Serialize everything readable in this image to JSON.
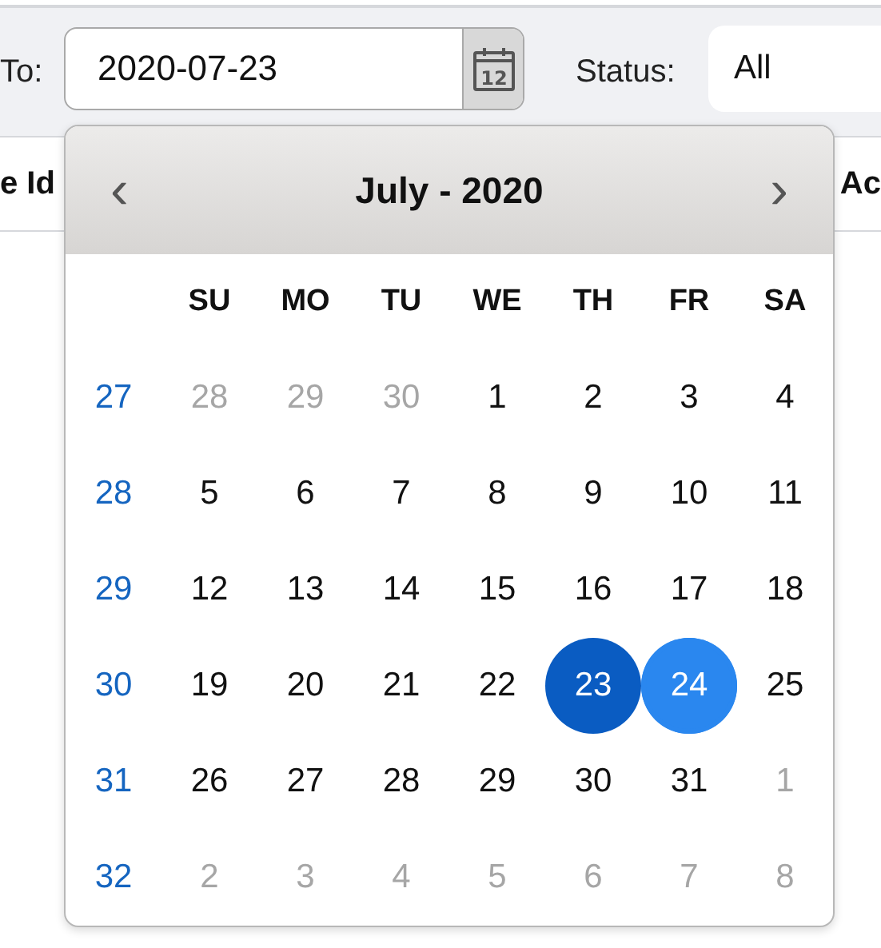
{
  "filter_bar": {
    "to_label": "To:",
    "to_field": {
      "value": "2020-07-23",
      "button_icon_day": "12"
    },
    "status_label": "Status:",
    "status_select": {
      "value": "All"
    }
  },
  "table": {
    "columns": [
      "e Id",
      "Ac"
    ]
  },
  "date_picker": {
    "title": "July - 2020",
    "prev": "‹",
    "next": "›",
    "weekdays": [
      "SU",
      "MO",
      "TU",
      "WE",
      "TH",
      "FR",
      "SA"
    ],
    "weeks": [
      {
        "number": "27",
        "days": [
          {
            "label": "28",
            "other_month": true,
            "selected": false,
            "highlighted": false
          },
          {
            "label": "29",
            "other_month": true,
            "selected": false,
            "highlighted": false
          },
          {
            "label": "30",
            "other_month": true,
            "selected": false,
            "highlighted": false
          },
          {
            "label": "1",
            "other_month": false,
            "selected": false,
            "highlighted": false
          },
          {
            "label": "2",
            "other_month": false,
            "selected": false,
            "highlighted": false
          },
          {
            "label": "3",
            "other_month": false,
            "selected": false,
            "highlighted": false
          },
          {
            "label": "4",
            "other_month": false,
            "selected": false,
            "highlighted": false
          }
        ]
      },
      {
        "number": "28",
        "days": [
          {
            "label": "5",
            "other_month": false,
            "selected": false,
            "highlighted": false
          },
          {
            "label": "6",
            "other_month": false,
            "selected": false,
            "highlighted": false
          },
          {
            "label": "7",
            "other_month": false,
            "selected": false,
            "highlighted": false
          },
          {
            "label": "8",
            "other_month": false,
            "selected": false,
            "highlighted": false
          },
          {
            "label": "9",
            "other_month": false,
            "selected": false,
            "highlighted": false
          },
          {
            "label": "10",
            "other_month": false,
            "selected": false,
            "highlighted": false
          },
          {
            "label": "11",
            "other_month": false,
            "selected": false,
            "highlighted": false
          }
        ]
      },
      {
        "number": "29",
        "days": [
          {
            "label": "12",
            "other_month": false,
            "selected": false,
            "highlighted": false
          },
          {
            "label": "13",
            "other_month": false,
            "selected": false,
            "highlighted": false
          },
          {
            "label": "14",
            "other_month": false,
            "selected": false,
            "highlighted": false
          },
          {
            "label": "15",
            "other_month": false,
            "selected": false,
            "highlighted": false
          },
          {
            "label": "16",
            "other_month": false,
            "selected": false,
            "highlighted": false
          },
          {
            "label": "17",
            "other_month": false,
            "selected": false,
            "highlighted": false
          },
          {
            "label": "18",
            "other_month": false,
            "selected": false,
            "highlighted": false
          }
        ]
      },
      {
        "number": "30",
        "days": [
          {
            "label": "19",
            "other_month": false,
            "selected": false,
            "highlighted": false
          },
          {
            "label": "20",
            "other_month": false,
            "selected": false,
            "highlighted": false
          },
          {
            "label": "21",
            "other_month": false,
            "selected": false,
            "highlighted": false
          },
          {
            "label": "22",
            "other_month": false,
            "selected": false,
            "highlighted": false
          },
          {
            "label": "23",
            "other_month": false,
            "selected": true,
            "highlighted": false
          },
          {
            "label": "24",
            "other_month": false,
            "selected": false,
            "highlighted": true
          },
          {
            "label": "25",
            "other_month": false,
            "selected": false,
            "highlighted": false
          }
        ]
      },
      {
        "number": "31",
        "days": [
          {
            "label": "26",
            "other_month": false,
            "selected": false,
            "highlighted": false
          },
          {
            "label": "27",
            "other_month": false,
            "selected": false,
            "highlighted": false
          },
          {
            "label": "28",
            "other_month": false,
            "selected": false,
            "highlighted": false
          },
          {
            "label": "29",
            "other_month": false,
            "selected": false,
            "highlighted": false
          },
          {
            "label": "30",
            "other_month": false,
            "selected": false,
            "highlighted": false
          },
          {
            "label": "31",
            "other_month": false,
            "selected": false,
            "highlighted": false
          },
          {
            "label": "1",
            "other_month": true,
            "selected": false,
            "highlighted": false
          }
        ]
      },
      {
        "number": "32",
        "days": [
          {
            "label": "2",
            "other_month": true,
            "selected": false,
            "highlighted": false
          },
          {
            "label": "3",
            "other_month": true,
            "selected": false,
            "highlighted": false
          },
          {
            "label": "4",
            "other_month": true,
            "selected": false,
            "highlighted": false
          },
          {
            "label": "5",
            "other_month": true,
            "selected": false,
            "highlighted": false
          },
          {
            "label": "6",
            "other_month": true,
            "selected": false,
            "highlighted": false
          },
          {
            "label": "7",
            "other_month": true,
            "selected": false,
            "highlighted": false
          },
          {
            "label": "8",
            "other_month": true,
            "selected": false,
            "highlighted": false
          }
        ]
      }
    ]
  }
}
